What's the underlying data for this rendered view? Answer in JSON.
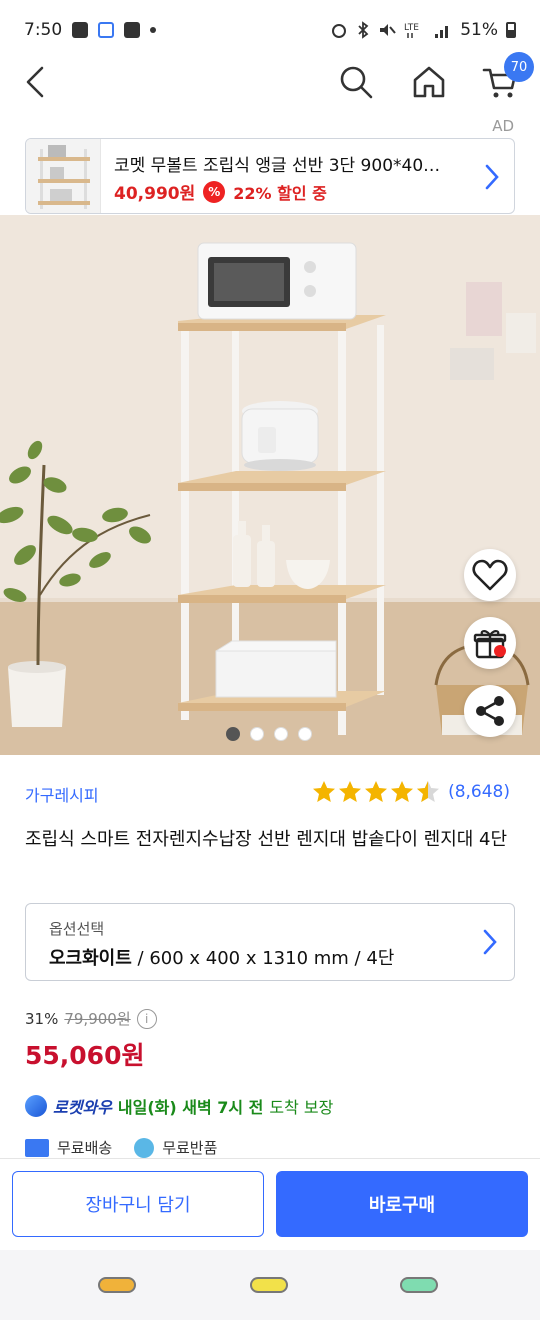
{
  "status_bar": {
    "time": "7:50",
    "battery": "51%"
  },
  "top_nav": {
    "cart_count": "70"
  },
  "ad": {
    "label": "AD",
    "title": "코멧 무볼트 조립식 앵글 선반 3단 900*40…",
    "price": "40,990원",
    "pct_symbol": "%",
    "discount": "22% 할인 중"
  },
  "carousel": {
    "total": 4,
    "active_index": 0
  },
  "product": {
    "brand": "가구레시피",
    "rating": 4.5,
    "review_count": "(8,648)",
    "title": "조립식 스마트 전자렌지수납장 선반 렌지대 밥솥다이 렌지대 4단"
  },
  "option": {
    "label": "옵션선택",
    "value_bold": "오크화이트",
    "value_rest": " / 600 x 400 x 1310 mm / 4단"
  },
  "price": {
    "discount_pct": "31%",
    "original": "79,900원",
    "info_symbol": "i",
    "sale": "55,060원"
  },
  "delivery": {
    "rocket_label": "로켓와우",
    "date": "내일(화) 새벽 7시 전",
    "note": "도착 보장",
    "free_shipping": "무료배송",
    "free_return": "무료반품"
  },
  "actions": {
    "cart_label": "장바구니 담기",
    "buy_label": "바로구매"
  },
  "colors": {
    "accent": "#346aff",
    "sale_red": "#c8102e",
    "green": "#1a8a1a"
  }
}
